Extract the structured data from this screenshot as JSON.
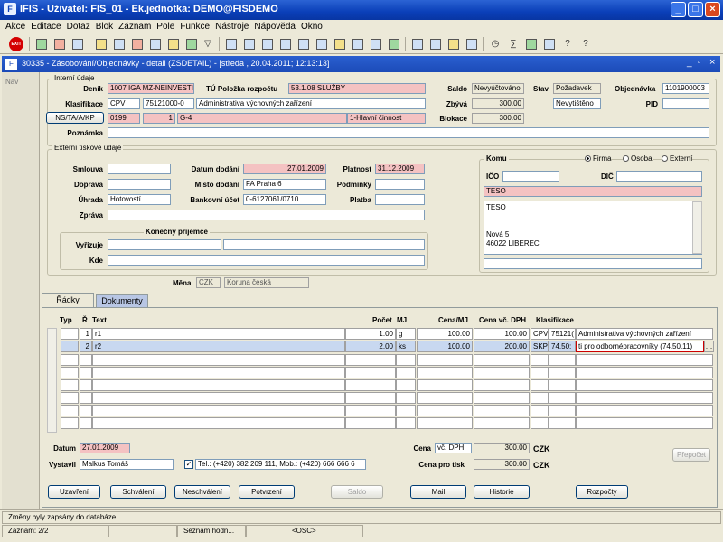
{
  "window": {
    "title": "IFIS - Uživatel: FIS_01 - Ek.jednotka: DEMO@FISDEMO"
  },
  "menu": [
    "Akce",
    "Editace",
    "Dotaz",
    "Blok",
    "Záznam",
    "Pole",
    "Funkce",
    "Nástroje",
    "Nápověda",
    "Okno"
  ],
  "exit_label": "EXIT",
  "form": {
    "title": "30335 - Zásobování/Objednávky - detail (ZSDETAIL) - [středa , 20.04.2011; 12:13:13]"
  },
  "nav_label": "Nav",
  "interni": {
    "group_title": "Interní údaje",
    "denik_label": "Deník",
    "denik_value": "1007 IGA MZ-NEINVESTI",
    "tu_label": "TÚ Položka rozpočtu",
    "tu_value": "53.1.08 SLUŽBY",
    "saldo_label": "Saldo",
    "saldo_value": "Nevyúčtováno",
    "stav_label": "Stav",
    "stav_value": "Požadavek",
    "obj_label": "Objednávka",
    "obj_value": "1101900003",
    "klas_label": "Klasifikace",
    "klas_a": "CPV",
    "klas_b": "75121000-0",
    "klas_c": "Administrativa výchovných zařízení",
    "zbyva_label": "Zbývá",
    "zbyva_value": "300.00",
    "nevyt_value": "Nevytištěno",
    "pid_label": "PID",
    "ns_button": "NS/TA/A/KP",
    "ns_a": "0199",
    "ns_b": "1",
    "ns_c": "G-4",
    "ns_d": "1-Hlavní činnost",
    "blok_label": "Blokace",
    "blok_value": "300.00",
    "poz_label": "Poznámka"
  },
  "externi": {
    "group_title": "Externí tiskové údaje",
    "smlouva_label": "Smlouva",
    "datum_label": "Datum dodání",
    "datum_value": "27.01.2009",
    "platnost_label": "Platnost",
    "platnost_value": "31.12.2009",
    "doprava_label": "Doprava",
    "misto_label": "Místo dodání",
    "misto_value": "FA Praha 6",
    "podminky_label": "Podmínky",
    "uhrada_label": "Úhrada",
    "uhrada_value": "Hotovostí",
    "bank_label": "Bankovní účet",
    "bank_value": "0-6127061/0710",
    "platba_label": "Platba",
    "zprava_label": "Zpráva"
  },
  "komu": {
    "group_title": "Komu",
    "firma": "Firma",
    "osoba": "Osoba",
    "externi": "Externí",
    "ico_label": "IČO",
    "dic_label": "DIČ",
    "name": "TESO",
    "address": [
      "TESO",
      "",
      "",
      "Nová 5",
      "46022  LIBEREC"
    ]
  },
  "konecny": {
    "group_title": "Konečný příjemce",
    "vyrizuje_label": "Vyřizuje",
    "kde_label": "Kde"
  },
  "mena": {
    "label": "Měna",
    "code": "CZK",
    "name": "Koruna česká"
  },
  "tabs": [
    "Řádky",
    "Dokumenty"
  ],
  "grid": {
    "headers": [
      "Typ",
      "Ř",
      "Text",
      "Počet",
      "MJ",
      "Cena/MJ",
      "Cena vč. DPH",
      "Klasifikace"
    ],
    "rows": [
      {
        "r": "1",
        "text": "r1",
        "pocet": "1.00",
        "mj": "g",
        "cena": "100.00",
        "cenadph": "100.00",
        "k1": "CPV",
        "k2": "75121(",
        "k3": "Administrativa výchovných zařízení"
      },
      {
        "r": "2",
        "text": "r2",
        "pocet": "2.00",
        "mj": "ks",
        "cena": "100.00",
        "cenadph": "200.00",
        "k1": "SKP",
        "k2": "74.50:",
        "k3": "ti pro odbornépracovníky (74.50.11)"
      }
    ]
  },
  "footer": {
    "datum_label": "Datum",
    "datum_value": "27.01.2009",
    "vystavil_label": "Vystavil",
    "vystavil_value": "Malkus Tomáš",
    "tel_value": "Tel.: (+420) 382 209 111, Mob.: (+420) 666 666 6",
    "cena_label": "Cena",
    "cena_type": "vč. DPH",
    "cena_value": "300.00",
    "cena_cur": "CZK",
    "cenatisk_label": "Cena pro tisk",
    "cenatisk_value": "300.00",
    "cenatisk_cur": "CZK",
    "prepocet": "Přepočet"
  },
  "buttons": [
    "Uzavření",
    "Schválení",
    "Neschválení",
    "Potvrzení",
    "Saldo",
    "Mail",
    "Historie",
    "Rozpočty"
  ],
  "status": {
    "message": "Změny byly zapsány do databáze.",
    "record": "Záznam: 2/2",
    "list": "Seznam hodn...",
    "osc": "<OSC>"
  }
}
